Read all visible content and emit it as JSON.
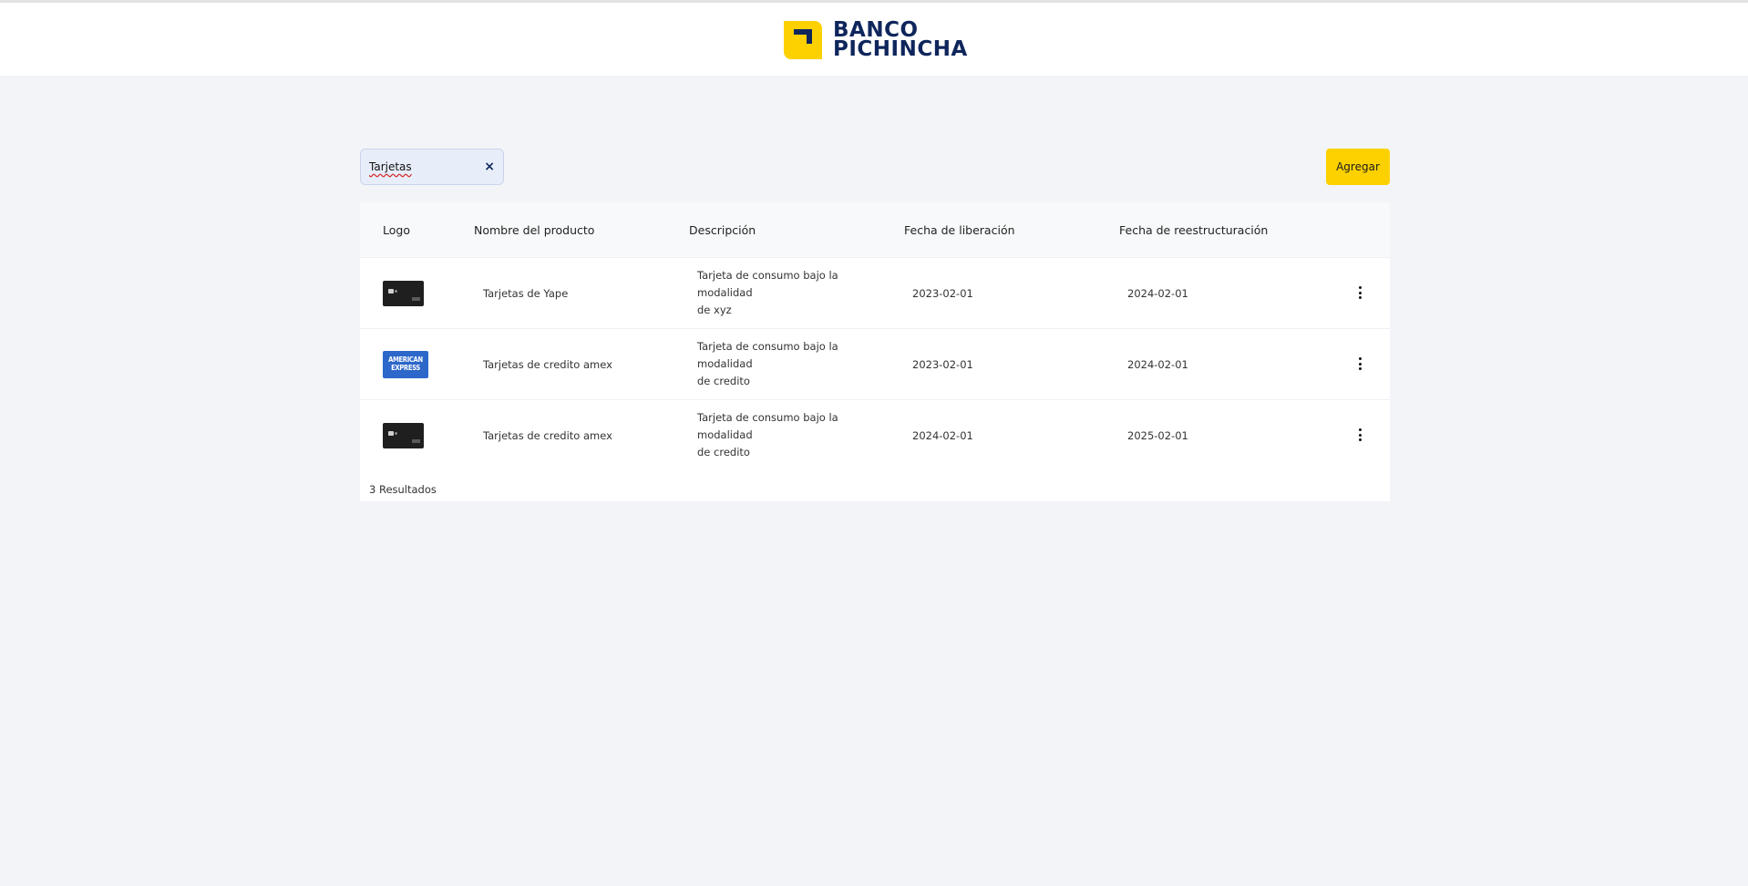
{
  "brand": {
    "line1": "BANCO",
    "line2": "PICHINCHA",
    "primary_color": "#fdd100",
    "secondary_color": "#0f265c"
  },
  "search": {
    "value": "Tarjetas",
    "clear_icon": "×"
  },
  "add_button": {
    "label": "Agregar"
  },
  "table": {
    "headers": {
      "logo": "Logo",
      "name": "Nombre del producto",
      "description": "Descripción",
      "release": "Fecha de liberación",
      "restructure": "Fecha de reestructuración"
    },
    "rows": [
      {
        "logo": "dark-card",
        "name": "Tarjetas de Yape",
        "description_line1": "Tarjeta de consumo bajo la modalidad",
        "description_line2": "de xyz",
        "release": "2023-02-01",
        "restructure": "2024-02-01"
      },
      {
        "logo": "amex-card",
        "logo_text_1": "AMERICAN",
        "logo_text_2": "EXPRESS",
        "name": "Tarjetas de credito amex",
        "description_line1": "Tarjeta de consumo bajo la modalidad",
        "description_line2": "de credito",
        "release": "2023-02-01",
        "restructure": "2024-02-01"
      },
      {
        "logo": "dark-card",
        "name": "Tarjetas de credito amex",
        "description_line1": "Tarjeta de consumo bajo la modalidad",
        "description_line2": "de credito",
        "release": "2024-02-01",
        "restructure": "2025-02-01"
      }
    ],
    "results": "3 Resultados"
  }
}
